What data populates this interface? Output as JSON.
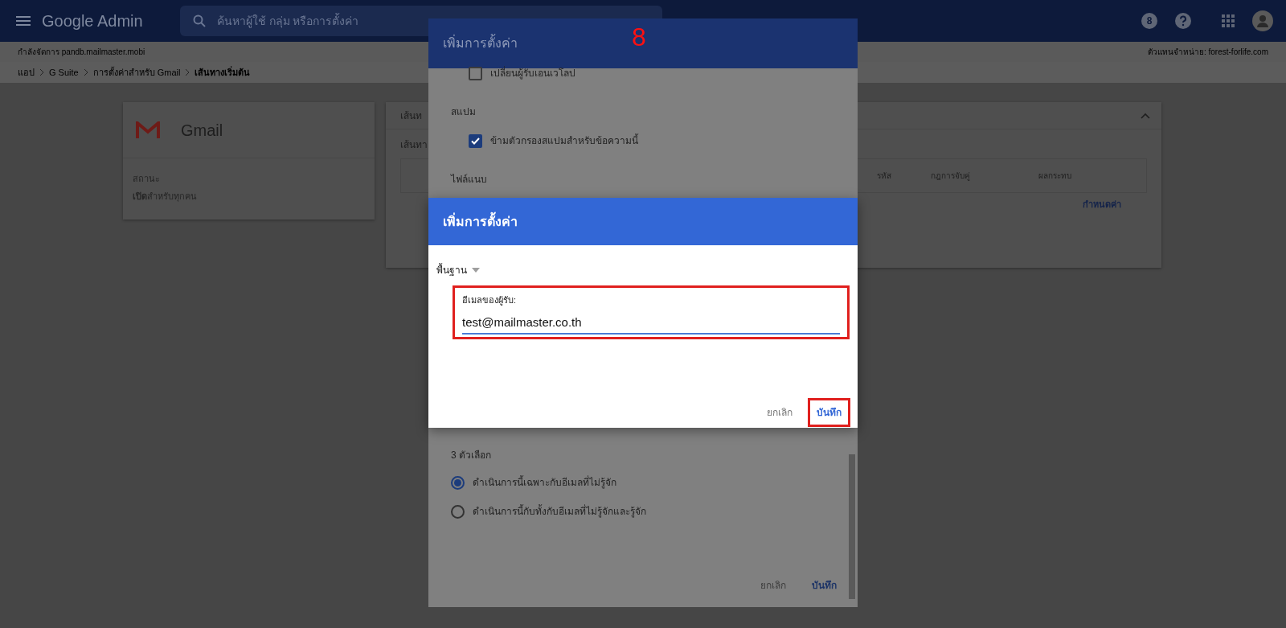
{
  "topbar": {
    "product": "Google Admin",
    "search_placeholder": "ค้นหาผู้ใช้ กลุ่ม หรือการตั้งค่า",
    "notification_count": "8"
  },
  "subbar": {
    "managing": "กำลังจัดการ pandb.mailmaster.mobi",
    "reseller": "ตัวแทนจำหน่าย: forest-forlife.com"
  },
  "breadcrumb": [
    {
      "label": "แอป",
      "current": false
    },
    {
      "label": "G Suite",
      "current": false
    },
    {
      "label": "การตั้งค่าสำหรับ Gmail",
      "current": false
    },
    {
      "label": "เส้นทางเริ่มต้น",
      "current": true
    }
  ],
  "app_card": {
    "name": "Gmail",
    "status_label": "สถานะ",
    "status_value": "**เปิด**สำหรับทุกคน"
  },
  "routing_card": {
    "title": "เส้นท",
    "subtitle": "เส้นทา",
    "columns": [
      "รหัส",
      "กฎการจับคู่",
      "ผลกระทบ"
    ],
    "configure_link": "กำหนดค่า"
  },
  "annotation": {
    "step": "8"
  },
  "settings_dialog": {
    "title": "เพิ่มการตั้งค่า",
    "items": [
      {
        "kind": "checkbox",
        "label": "เปลี่ยนผู้รับเอนเวโลป",
        "checked": false
      },
      {
        "kind": "heading",
        "label": "สแปม"
      },
      {
        "kind": "checkbox",
        "label": "ข้ามตัวกรองสแปมสำหรับข้อความนี้",
        "checked": true
      },
      {
        "kind": "heading",
        "label": "ไฟล์แนบ"
      }
    ],
    "options_label": "3 ตัวเลือก",
    "options": [
      {
        "label": "ดำเนินการนี้เฉพาะกับอีเมลที่ไม่รู้จัก",
        "selected": true
      },
      {
        "label": "ดำเนินการนี้กับทั้งกับอีเมลที่ไม่รู้จักและรู้จัก",
        "selected": false
      }
    ],
    "buttons": [
      {
        "label": "ยกเลิก",
        "kind": "cancel"
      },
      {
        "label": "บันทึก",
        "kind": "primary"
      }
    ]
  },
  "add_dialog": {
    "title": "เพิ่มการตั้งค่า",
    "mode": "พื้นฐาน",
    "field_label": "อีเมลของผู้รับ:",
    "field_value": "test@mailmaster.co.th",
    "field_highlighted": true,
    "buttons": [
      {
        "label": "ยกเลิก",
        "kind": "cancel",
        "highlighted": false
      },
      {
        "label": "บันทึก",
        "kind": "primary",
        "highlighted": true
      }
    ]
  }
}
